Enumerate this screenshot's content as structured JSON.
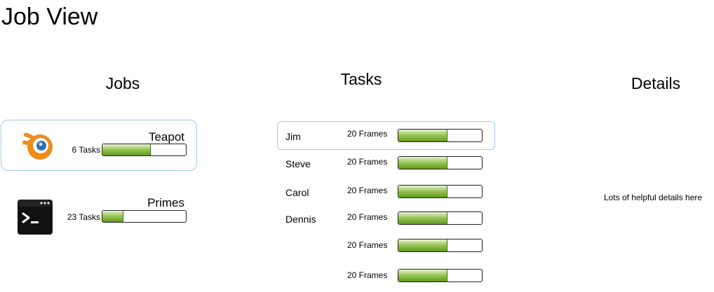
{
  "page": {
    "title": "Job View"
  },
  "columns": {
    "jobs": "Jobs",
    "tasks": "Tasks",
    "details": "Details"
  },
  "jobs": [
    {
      "name": "Teapot",
      "tasks_label": "6 Tasks",
      "progress": 0.58,
      "icon": "blender-icon",
      "selected": true
    },
    {
      "name": "Primes",
      "tasks_label": "23 Tasks",
      "progress": 0.25,
      "icon": "terminal-icon",
      "selected": false
    }
  ],
  "tasks": [
    {
      "name": "Jim",
      "frames_label": "20 Frames",
      "progress": 0.59,
      "selected": true
    },
    {
      "name": "Steve",
      "frames_label": "20 Frames",
      "progress": 0.59,
      "selected": false
    },
    {
      "name": "Carol",
      "frames_label": "20 Frames",
      "progress": 0.59,
      "selected": false
    },
    {
      "name": "Dennis",
      "frames_label": "20 Frames",
      "progress": 0.59,
      "selected": false
    },
    {
      "name": "",
      "frames_label": "20 Frames",
      "progress": 0.59,
      "selected": false
    },
    {
      "name": "",
      "frames_label": "20 Frames",
      "progress": 0.59,
      "selected": false
    }
  ],
  "details": {
    "text": "Lots of helpful details here"
  },
  "colors": {
    "selection_border": "#9fcbe8",
    "progress_green": "#6fa72a",
    "blender_orange": "#f08a1d",
    "blender_blue": "#2a6fb7"
  }
}
